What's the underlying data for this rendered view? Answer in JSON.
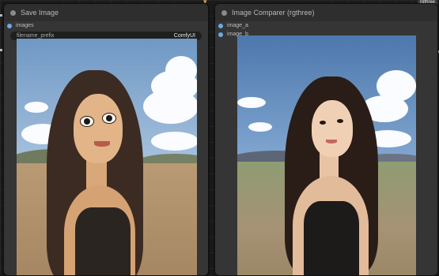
{
  "nodes": {
    "save_image": {
      "title": "Save Image",
      "input_label": "images",
      "widget": {
        "label": "filename_prefix",
        "value": "ComfyUI"
      }
    },
    "image_comparer": {
      "title": "Image Comparer (rgthree)",
      "input_a": "image_a",
      "input_b": "image_b"
    }
  },
  "top_right_badge": "rgthree",
  "colors": {
    "canvas": "#1b1b1b",
    "node_body": "#353535",
    "node_header": "#2e2e2e",
    "slot_dot": "#69a9e9",
    "corner_icon": "#e7a33e"
  },
  "icons": {
    "corner": "chevron-down-icon",
    "collapse": "collapse-dot-icon"
  }
}
